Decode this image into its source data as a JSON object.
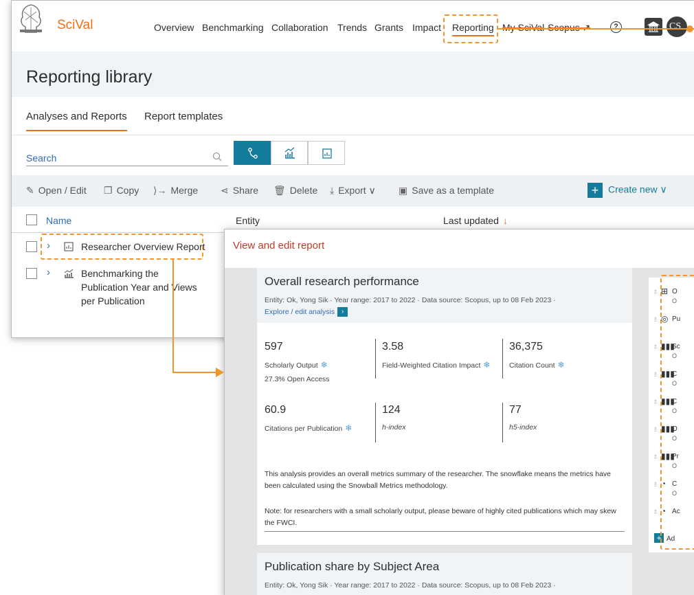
{
  "app": {
    "brand": "SciVal"
  },
  "nav": {
    "overview": "Overview",
    "benchmarking": "Benchmarking",
    "collaboration": "Collaboration",
    "trends": "Trends",
    "grants": "Grants",
    "impact": "Impact",
    "reporting": "Reporting",
    "myscival": "My SciVal",
    "scopus": "Scopus ↗",
    "help": "?",
    "avatar": "CS"
  },
  "page": {
    "title": "Reporting library"
  },
  "tabs": {
    "analyses": "Analyses and Reports",
    "templates": "Report templates"
  },
  "search": {
    "placeholder": "Search"
  },
  "toolbar": {
    "open_edit": "Open / Edit",
    "copy": "Copy",
    "merge": "Merge",
    "share": "Share",
    "delete": "Delete",
    "export": "Export ∨",
    "save_template": "Save as a template",
    "create_new": "Create new ∨"
  },
  "table": {
    "col_name": "Name",
    "col_entity": "Entity",
    "col_updated": "Last updated",
    "rows": [
      {
        "title": "Researcher Overview Report"
      },
      {
        "title": "Benchmarking the Publication Year and Views per Publication"
      }
    ]
  },
  "panel": {
    "title": "View and edit report",
    "card1": {
      "title": "Overall research performance",
      "meta": "Entity: Ok, Yong Sik  ·  Year range: 2017 to 2022 ·  Data source: Scopus, up to 08 Feb 2023 ·",
      "explore": "Explore / edit analysis",
      "metrics": [
        {
          "value": "597",
          "label": "Scholarly Output",
          "sub": "27.3% Open Access"
        },
        {
          "value": "3.58",
          "label": "Field-Weighted Citation Impact"
        },
        {
          "value": "36,375",
          "label": "Citation Count"
        },
        {
          "value": "60.9",
          "label": "Citations per Publication"
        },
        {
          "value": "124",
          "label": "h-index"
        },
        {
          "value": "77",
          "label": "h5-index"
        }
      ],
      "note1": "This analysis provides an overall metrics summary of the researcher. The snowflake means the metrics have been calculated using the Snowball Metrics methodology.",
      "note2": "Note: for researchers with a small scholarly output, please beware of highly cited publications which may skew the FWCI."
    },
    "card2": {
      "title": "Publication share by Subject Area",
      "meta": "Entity: Ok, Yong Sik  ·  Year range: 2017 to 2022 ·  Data source: Scopus, up to 08 Feb 2023 ·"
    },
    "side": {
      "items": [
        {
          "icon": "table-icon",
          "label": "O",
          "sub": "O"
        },
        {
          "icon": "person-icon",
          "label": "Pu",
          "sub": ""
        },
        {
          "icon": "bar-chart-icon",
          "label": "Sc",
          "sub": "O"
        },
        {
          "icon": "bar-chart-icon",
          "label": "C",
          "sub": "O"
        },
        {
          "icon": "bar-chart-icon",
          "label": "C",
          "sub": "O"
        },
        {
          "icon": "bar-chart-icon",
          "label": "O",
          "sub": "O"
        },
        {
          "icon": "bar-chart-icon",
          "label": "Pr",
          "sub": "O"
        },
        {
          "icon": "pie-chart-icon",
          "label": "C",
          "sub": "O"
        },
        {
          "icon": "pie-chart-icon",
          "label": "Ac",
          "sub": ""
        }
      ],
      "add": "Ad"
    }
  },
  "colors": {
    "accent_orange": "#e9711c",
    "teal": "#137c9b",
    "link_blue": "#2f6bb3",
    "annotation": "#f0962f"
  }
}
